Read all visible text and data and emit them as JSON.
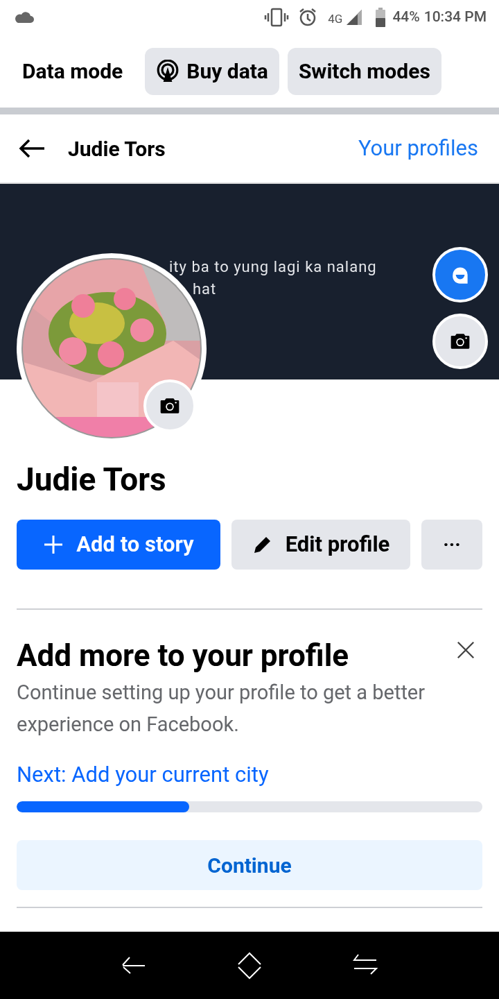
{
  "status_bar": {
    "battery": "44%",
    "time": "10:34 PM",
    "network": "4G"
  },
  "data_bar": {
    "label": "Data mode",
    "buttons": [
      {
        "kind": "buy",
        "label": "Buy data"
      },
      {
        "kind": "switch",
        "label": "Switch modes"
      }
    ]
  },
  "header": {
    "title": "Judie Tors",
    "link": "Your profiles"
  },
  "cover": {
    "text_lines": [
      "ity ba to yung lagi ka nalang",
      "hat"
    ]
  },
  "profile": {
    "name": "Judie Tors",
    "actions": [
      {
        "kind": "primary",
        "label": "Add to story"
      },
      {
        "kind": "edit",
        "label": "Edit profile"
      },
      {
        "kind": "more",
        "label": "···"
      }
    ]
  },
  "card": {
    "title": "Add more to your profile",
    "body": "Continue setting up your profile to get a better experience on Facebook.",
    "next": "Next: Add your current city",
    "level": 0.37,
    "button": "Continue"
  }
}
